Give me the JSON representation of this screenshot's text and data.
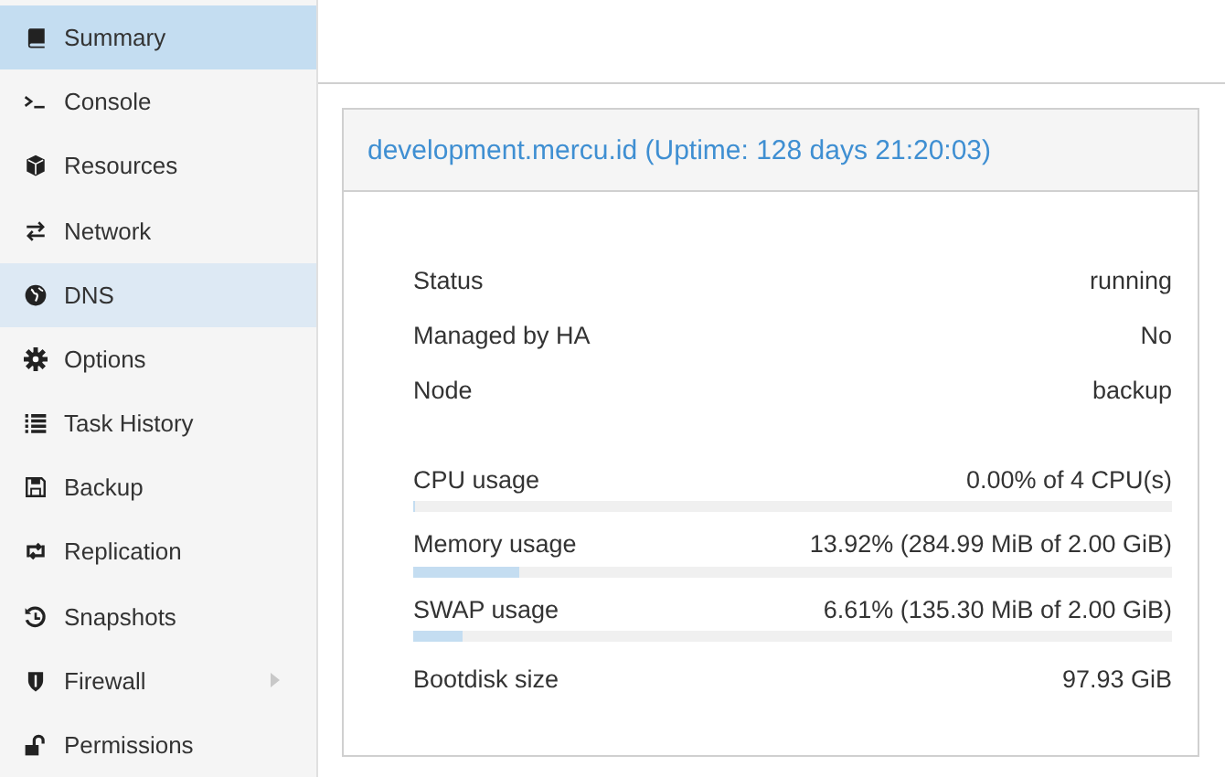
{
  "sidebar": {
    "items": [
      {
        "label": "Summary",
        "selected": true,
        "hovered": false,
        "has_submenu": false
      },
      {
        "label": "Console",
        "selected": false,
        "hovered": false,
        "has_submenu": false
      },
      {
        "label": "Resources",
        "selected": false,
        "hovered": false,
        "has_submenu": false
      },
      {
        "label": "Network",
        "selected": false,
        "hovered": false,
        "has_submenu": false
      },
      {
        "label": "DNS",
        "selected": false,
        "hovered": true,
        "has_submenu": false
      },
      {
        "label": "Options",
        "selected": false,
        "hovered": false,
        "has_submenu": false
      },
      {
        "label": "Task History",
        "selected": false,
        "hovered": false,
        "has_submenu": false
      },
      {
        "label": "Backup",
        "selected": false,
        "hovered": false,
        "has_submenu": false
      },
      {
        "label": "Replication",
        "selected": false,
        "hovered": false,
        "has_submenu": false
      },
      {
        "label": "Snapshots",
        "selected": false,
        "hovered": false,
        "has_submenu": false
      },
      {
        "label": "Firewall",
        "selected": false,
        "hovered": false,
        "has_submenu": true
      },
      {
        "label": "Permissions",
        "selected": false,
        "hovered": false,
        "has_submenu": false
      }
    ]
  },
  "panel": {
    "title": "development.mercu.id (Uptime: 128 days 21:20:03)",
    "sections": [
      {
        "rows": [
          {
            "kind": "text",
            "label": "Status",
            "value": "running"
          },
          {
            "kind": "text",
            "label": "Managed by HA",
            "value": "No"
          },
          {
            "kind": "text",
            "label": "Node",
            "value": "backup"
          }
        ]
      },
      {
        "rows": [
          {
            "kind": "meter",
            "label": "CPU usage",
            "value": "0.00% of 4 CPU(s)",
            "level": 0
          },
          {
            "kind": "meter",
            "label": "Memory usage",
            "value": "13.92% (284.99 MiB of 2.00 GiB)",
            "level": 0.1392
          },
          {
            "kind": "meter",
            "label": "SWAP usage",
            "value": "6.61% (135.30 MiB of 2.00 GiB)",
            "level": 0.0661
          },
          {
            "kind": "text",
            "label": "Bootdisk size",
            "value": "97.93 GiB"
          }
        ]
      }
    ]
  }
}
